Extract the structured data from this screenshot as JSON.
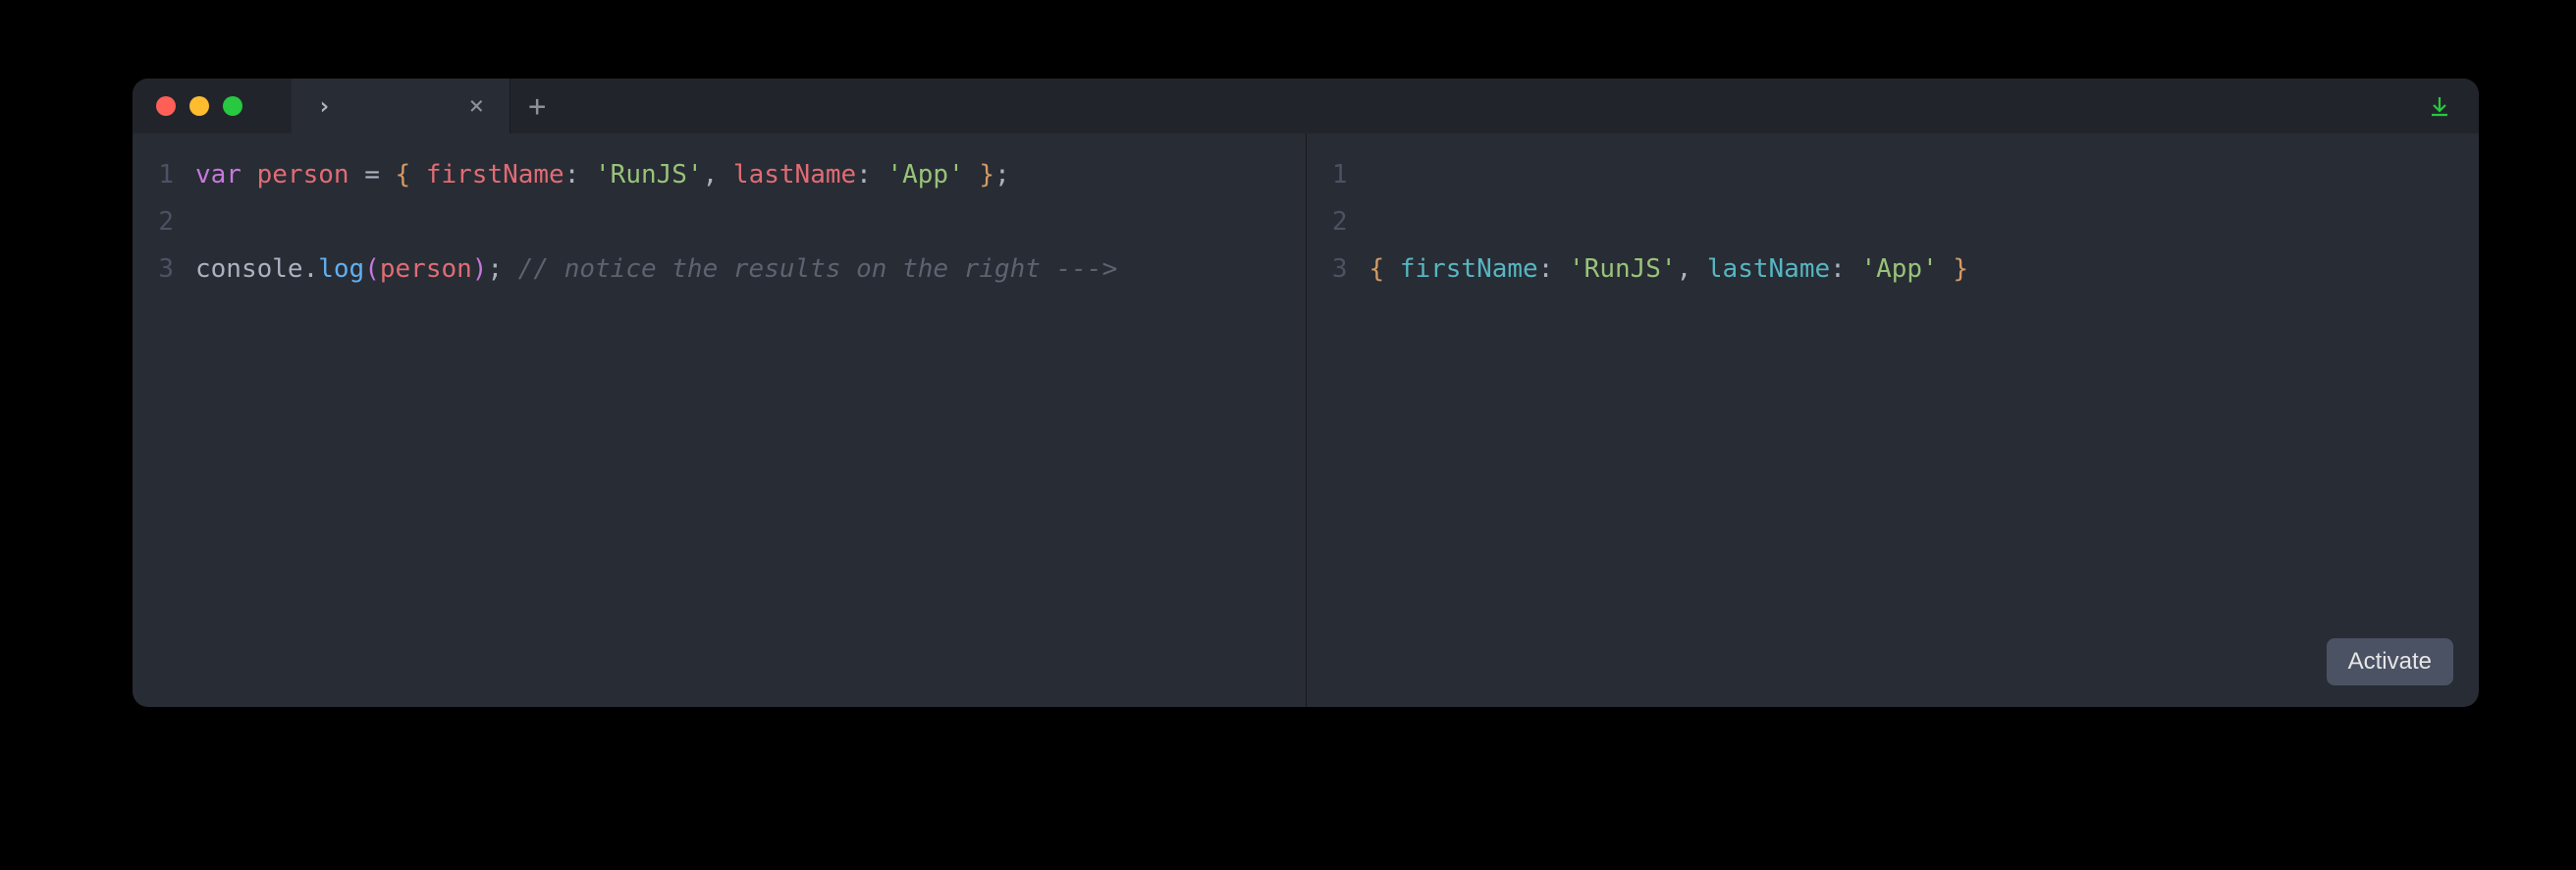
{
  "window": {
    "tab_title": "›",
    "tab_new_glyph": "+",
    "tab_close_glyph": "×"
  },
  "editor": {
    "line_numbers": [
      "1",
      "2",
      "3"
    ],
    "lines": [
      {
        "tokens": [
          {
            "cls": "tok-kw",
            "t": "var"
          },
          {
            "cls": "tok-punc",
            "t": " "
          },
          {
            "cls": "tok-var",
            "t": "person"
          },
          {
            "cls": "tok-punc",
            "t": " "
          },
          {
            "cls": "tok-punc",
            "t": "="
          },
          {
            "cls": "tok-punc",
            "t": " "
          },
          {
            "cls": "tok-brace",
            "t": "{"
          },
          {
            "cls": "tok-punc",
            "t": " "
          },
          {
            "cls": "tok-prop",
            "t": "firstName"
          },
          {
            "cls": "tok-punc",
            "t": ":"
          },
          {
            "cls": "tok-punc",
            "t": " "
          },
          {
            "cls": "tok-str",
            "t": "'RunJS'"
          },
          {
            "cls": "tok-punc",
            "t": ","
          },
          {
            "cls": "tok-punc",
            "t": " "
          },
          {
            "cls": "tok-prop",
            "t": "lastName"
          },
          {
            "cls": "tok-punc",
            "t": ":"
          },
          {
            "cls": "tok-punc",
            "t": " "
          },
          {
            "cls": "tok-str",
            "t": "'App'"
          },
          {
            "cls": "tok-punc",
            "t": " "
          },
          {
            "cls": "tok-brace",
            "t": "}"
          },
          {
            "cls": "tok-punc",
            "t": ";"
          }
        ]
      },
      {
        "tokens": []
      },
      {
        "tokens": [
          {
            "cls": "tok-id",
            "t": "console"
          },
          {
            "cls": "tok-punc",
            "t": "."
          },
          {
            "cls": "tok-fn",
            "t": "log"
          },
          {
            "cls": "tok-paren",
            "t": "("
          },
          {
            "cls": "tok-var",
            "t": "person"
          },
          {
            "cls": "tok-paren",
            "t": ")"
          },
          {
            "cls": "tok-punc",
            "t": ";"
          },
          {
            "cls": "tok-punc",
            "t": " "
          },
          {
            "cls": "tok-comm",
            "t": "// notice the results on the right --->"
          }
        ]
      }
    ]
  },
  "output": {
    "line_numbers": [
      "1",
      "2",
      "3"
    ],
    "lines": [
      {
        "tokens": []
      },
      {
        "tokens": []
      },
      {
        "tokens": [
          {
            "cls": "tok-brace",
            "t": "{"
          },
          {
            "cls": "tok-punc",
            "t": " "
          },
          {
            "cls": "tok-outprop",
            "t": "firstName"
          },
          {
            "cls": "tok-punc",
            "t": ":"
          },
          {
            "cls": "tok-punc",
            "t": " "
          },
          {
            "cls": "tok-str",
            "t": "'RunJS'"
          },
          {
            "cls": "tok-punc",
            "t": ","
          },
          {
            "cls": "tok-punc",
            "t": " "
          },
          {
            "cls": "tok-outprop",
            "t": "lastName"
          },
          {
            "cls": "tok-punc",
            "t": ":"
          },
          {
            "cls": "tok-punc",
            "t": " "
          },
          {
            "cls": "tok-str",
            "t": "'App'"
          },
          {
            "cls": "tok-punc",
            "t": " "
          },
          {
            "cls": "tok-brace",
            "t": "}"
          }
        ]
      }
    ]
  },
  "buttons": {
    "activate": "Activate"
  }
}
